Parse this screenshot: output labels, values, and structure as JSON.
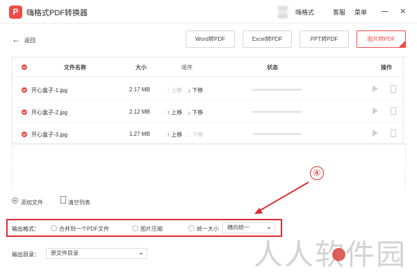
{
  "app": {
    "logo_glyph": "P",
    "title": "嗨格式PDF转换器"
  },
  "menu": {
    "user": "嗨格式",
    "service": "客服",
    "main": "菜单"
  },
  "toolbar": {
    "back_label": "返回",
    "tabs": [
      {
        "label": "Word转PDF",
        "active": false
      },
      {
        "label": "Excel转PDF",
        "active": false
      },
      {
        "label": "PPT转PDF",
        "active": false
      },
      {
        "label": "图片转PDF",
        "active": true
      }
    ]
  },
  "table": {
    "headers": {
      "name": "文件名称",
      "size": "大小",
      "order": "顺序",
      "status": "状态",
      "action": "操作"
    },
    "rows": [
      {
        "name": "开心盒子-1.jpg",
        "size": "2.17 MB",
        "up": "上移",
        "down": "下移",
        "up_enabled": false,
        "down_enabled": true,
        "progress": 0.0
      },
      {
        "name": "开心盒子-2.jpg",
        "size": "2.12 MB",
        "up": "上移",
        "down": "下移",
        "up_enabled": true,
        "down_enabled": true,
        "progress": 0.0
      },
      {
        "name": "开心盒子-3.jpg",
        "size": "1.27 MB",
        "up": "上移",
        "down": "下移",
        "up_enabled": true,
        "down_enabled": false,
        "progress": 0.0
      }
    ]
  },
  "actions": {
    "add_file": "添加文件",
    "clear_list": "清空列表"
  },
  "output_format": {
    "label": "输出格式：",
    "options": [
      {
        "label": "合并到一个PDF文件",
        "checked": false
      },
      {
        "label": "图片压缩",
        "checked": false
      },
      {
        "label": "统一大小",
        "checked": false
      }
    ],
    "size_select_value": "横向统一"
  },
  "output_dir": {
    "label": "输出目录：",
    "value": "原文件目录"
  },
  "annotation": {
    "step": "④"
  },
  "watermark": {
    "text": "人人软件园"
  },
  "colors": {
    "accent": "#ef4b48",
    "annotation": "#e02a2a"
  }
}
